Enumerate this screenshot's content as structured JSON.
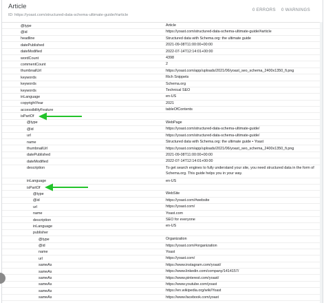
{
  "panel": {
    "title": "Article",
    "id_line": "ID: https://yoast.com/structured-data-schema-ultimate-guide/#article",
    "errors": "0 ERRORS",
    "warnings": "0 WARNINGS"
  },
  "rows": [
    {
      "key": "@type",
      "value": "Article",
      "indent": 0
    },
    {
      "key": "@id",
      "value": "https://yoast.com/structured-data-schema-ultimate-guide/#article",
      "indent": 0
    },
    {
      "key": "headline",
      "value": "Structured data with Schema.org: the ultimate guide",
      "indent": 0
    },
    {
      "key": "datePublished",
      "value": "2021-09-08T11:00:00+00:00",
      "indent": 0
    },
    {
      "key": "dateModified",
      "value": "2022-07-14T12:14:01+00:00",
      "indent": 0
    },
    {
      "key": "wordCount",
      "value": "4398",
      "indent": 0
    },
    {
      "key": "commentCount",
      "value": "2",
      "indent": 0
    },
    {
      "key": "thumbnailUrl",
      "value": "https://yoast.com/app/uploads/2021/06/yoast_seo_schema_2400x1350_fi.png",
      "indent": 0
    },
    {
      "key": "keywords",
      "value": "Rich Snippets",
      "indent": 0
    },
    {
      "key": "keywords",
      "value": "Schema.org",
      "indent": 0
    },
    {
      "key": "keywords",
      "value": "Technical SEO",
      "indent": 0
    },
    {
      "key": "inLanguage",
      "value": "en-US",
      "indent": 0
    },
    {
      "key": "copyrightYear",
      "value": "2021",
      "indent": 0
    },
    {
      "key": "accessibilityFeature",
      "value": "tableOfContents",
      "indent": 0
    },
    {
      "key": "isPartOf",
      "value": "",
      "indent": 0,
      "arrow": true
    },
    {
      "key": "@type",
      "value": "WebPage",
      "indent": 1
    },
    {
      "key": "@id",
      "value": "https://yoast.com/structured-data-schema-ultimate-guide/",
      "indent": 1
    },
    {
      "key": "url",
      "value": "https://yoast.com/structured-data-schema-ultimate-guide/",
      "indent": 1
    },
    {
      "key": "name",
      "value": "Structured data with Schema.org: the ultimate guide • Yoast",
      "indent": 1
    },
    {
      "key": "thumbnailUrl",
      "value": "https://yoast.com/app/uploads/2021/06/yoast_seo_schema_2400x1350_fi.png",
      "indent": 1
    },
    {
      "key": "datePublished",
      "value": "2021-09-08T11:00:00+00:00",
      "indent": 1
    },
    {
      "key": "dateModified",
      "value": "2022-07-14T12:14:01+00:00",
      "indent": 1
    },
    {
      "key": "description",
      "value": "To get search engines to fully understand your site, you need structured data in the form of Schema.org. This guide helps you in your way.",
      "indent": 1,
      "tall": true
    },
    {
      "key": "inLanguage",
      "value": "en-US",
      "indent": 1
    },
    {
      "key": "isPartOf",
      "value": "",
      "indent": 1,
      "arrow": true
    },
    {
      "key": "@type",
      "value": "WebSite",
      "indent": 2
    },
    {
      "key": "@id",
      "value": "https://yoast.com/#website",
      "indent": 2
    },
    {
      "key": "url",
      "value": "https://yoast.com/",
      "indent": 2
    },
    {
      "key": "name",
      "value": "Yoast.com",
      "indent": 2
    },
    {
      "key": "description",
      "value": "SEO for everyone",
      "indent": 2
    },
    {
      "key": "inLanguage",
      "value": "en-US",
      "indent": 2
    },
    {
      "key": "publisher",
      "value": "",
      "indent": 2
    },
    {
      "key": "@type",
      "value": "Organization",
      "indent": 3
    },
    {
      "key": "@id",
      "value": "https://yoast.com/#organization",
      "indent": 3
    },
    {
      "key": "name",
      "value": "Yoast",
      "indent": 3
    },
    {
      "key": "url",
      "value": "https://yoast.com/",
      "indent": 3
    },
    {
      "key": "sameAs",
      "value": "https://www.instagram.com/yoast/",
      "indent": 3
    },
    {
      "key": "sameAs",
      "value": "https://www.linkedin.com/company/1414157/",
      "indent": 3
    },
    {
      "key": "sameAs",
      "value": "https://www.pinterest.com/yoast/",
      "indent": 3
    },
    {
      "key": "sameAs",
      "value": "https://www.youtube.com/yoast",
      "indent": 3
    },
    {
      "key": "sameAs",
      "value": "https://en.wikipedia.org/wiki/Yoast",
      "indent": 3
    },
    {
      "key": "sameAs",
      "value": "https://www.facebook.com/yoast",
      "indent": 3
    }
  ],
  "colors": {
    "arrow": "#22c32a",
    "border": "#dadce0",
    "muted_text": "#80868b"
  },
  "icons": {
    "annotation": "green-arrow-icon",
    "scroll": "scroll-fab-icon"
  }
}
